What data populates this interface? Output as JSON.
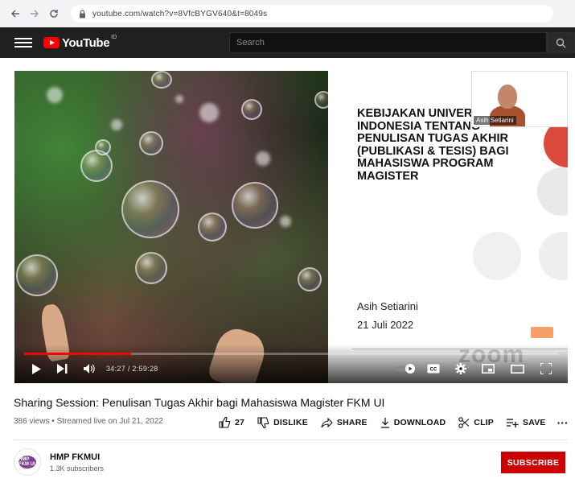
{
  "browser": {
    "url": "youtube.com/watch?v=8VfcBYGV640&t=8049s"
  },
  "header": {
    "logo_text": "YouTube",
    "logo_sup": "ID",
    "search_placeholder": "Search"
  },
  "player": {
    "slide": {
      "title": "KEBIJAKAN UNIVERSITAS INDONESIA TENTANG PENULISAN TUGAS AKHIR (PUBLIKASI & TESIS) BAGI MAHASISWA PROGRAM MAGISTER",
      "presenter": "Asih Setiarini",
      "date": "21 Juli 2022"
    },
    "camera_label": "Asih Setiarini",
    "watermark": "zoom",
    "progress": 0.2,
    "time_display": "34:27 / 2:59:28"
  },
  "video": {
    "title": "Sharing Session: Penulisan Tugas Akhir bagi Mahasiswa Magister FKM UI",
    "meta": "386 views • Streamed live on Jul 21, 2022",
    "actions": {
      "like": "27",
      "dislike": "DISLIKE",
      "share": "SHARE",
      "download": "DOWNLOAD",
      "clip": "CLIP",
      "save": "SAVE"
    }
  },
  "channel": {
    "avatar_text": "HMP FKM UI",
    "name": "HMP FKMUI",
    "subscribers": "1.3K subscribers",
    "subscribe_label": "SUBSCRIBE"
  },
  "colors": {
    "brand_red": "#ff0000",
    "subscribe_red": "#cc0000",
    "header_bg": "#202020"
  }
}
